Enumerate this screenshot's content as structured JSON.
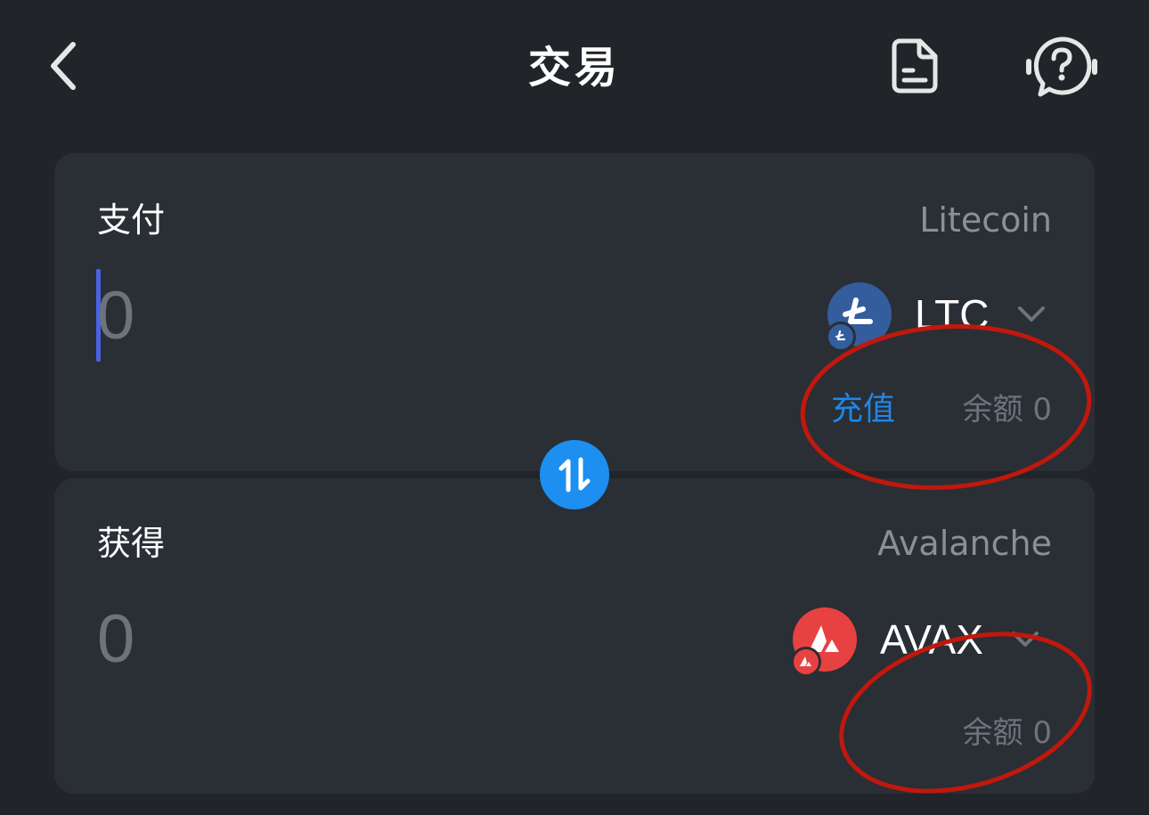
{
  "header": {
    "title": "交易",
    "back_icon": "chevron-left-icon",
    "records_icon": "document-icon",
    "help_icon": "help-chat-icon"
  },
  "pay": {
    "label": "支付",
    "network": "Litecoin",
    "amount_placeholder": "0",
    "token_symbol": "LTC",
    "token_icon": "litecoin-icon",
    "deposit_label": "充值",
    "balance_text": "余额 0",
    "token_color": "#345d9d"
  },
  "receive": {
    "label": "获得",
    "network": "Avalanche",
    "amount": "0",
    "token_symbol": "AVAX",
    "token_icon": "avalanche-icon",
    "balance_text": "余额 0",
    "token_color": "#e84142"
  },
  "swap": {
    "icon": "swap-arrows-icon",
    "color": "#1c8ff0"
  },
  "colors": {
    "background": "#212529",
    "card": "#2a2e35",
    "accent_link": "#1e88e5",
    "caret": "#4a63e6",
    "annotation": "#c0180c"
  }
}
